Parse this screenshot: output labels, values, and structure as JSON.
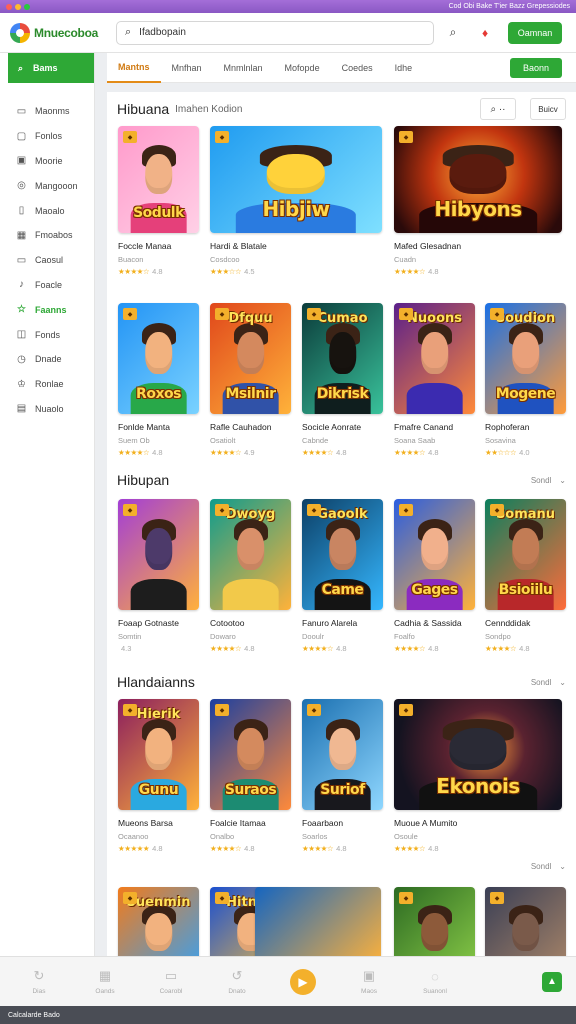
{
  "titlebar": {
    "text": "Cod Obi Bake T'ier Bazz Grepessiodes"
  },
  "topbar": {
    "logo_text": "Mnuecoboa",
    "search_value": "Ifadbopain",
    "cta_label": "Oamnan"
  },
  "sidebar": {
    "home_label": "Bams",
    "items": [
      {
        "label": "Maonms",
        "icon": "controller-icon",
        "glyph": "▭"
      },
      {
        "label": "Fonlos",
        "icon": "folder-icon",
        "glyph": "▢"
      },
      {
        "label": "Moorie",
        "icon": "film-icon",
        "glyph": "▣"
      },
      {
        "label": "Mangooon",
        "icon": "disc-icon",
        "glyph": "◎"
      },
      {
        "label": "Maoalo",
        "icon": "bookmark-icon",
        "glyph": "▯"
      },
      {
        "label": "Fmoabos",
        "icon": "gift-icon",
        "glyph": "▦"
      },
      {
        "label": "Caosul",
        "icon": "tv-icon",
        "glyph": "▭"
      },
      {
        "label": "Foacle",
        "icon": "music-icon",
        "glyph": "♪"
      },
      {
        "label": "Faanns",
        "icon": "star-icon",
        "glyph": "☆"
      },
      {
        "label": "Fonds",
        "icon": "puzzle-icon",
        "glyph": "◫"
      },
      {
        "label": "Dnade",
        "icon": "clock-icon",
        "glyph": "◷"
      },
      {
        "label": "Ronlae",
        "icon": "trophy-icon",
        "glyph": "♔"
      },
      {
        "label": "Nuaolo",
        "icon": "grid-icon",
        "glyph": "▤"
      }
    ],
    "active_index": 8
  },
  "tabs": [
    "Mantns",
    "Mnfhan",
    "Mnmlnlan",
    "Mofopde",
    "Coedes",
    "Idhe"
  ],
  "tab_button": "Baonn",
  "sections": [
    {
      "title": "Hibuana",
      "subtitle": "Imahen Kodion",
      "search_label": "⌕ ··",
      "filter_label": "Buicv",
      "cards": [
        {
          "title": "Foccle Manaa",
          "sub": "Buacon",
          "stars": "★★★★☆",
          "rating": "4.8",
          "thumb_text": "Sodulk",
          "top_text": "",
          "bg": "linear-gradient(135deg,#ff9acb,#ffd0e6)",
          "skin": "#f1b287",
          "body": "#e5407a",
          "wide": false
        },
        {
          "title": "Hardi & Blatale",
          "sub": "Cosdcoo",
          "stars": "★★★☆☆",
          "rating": "4.5",
          "thumb_text": "Hibjiw",
          "top_text": "",
          "bg": "linear-gradient(135deg,#1f9bf0,#7fe0ff)",
          "skin": "#ffd23a",
          "body": "#2a7be0",
          "wide": true
        },
        {
          "title": "Mafed Glesadnan",
          "sub": "Cuadn",
          "stars": "★★★★☆",
          "rating": "4.8",
          "thumb_text": "Hibyons",
          "top_text": "",
          "bg": "radial-gradient(circle at 50% 45%,#ffb23a,#c2350f 45%,#2a0a0a 90%)",
          "skin": "#5a1b0e",
          "body": "#250707",
          "wide": true
        }
      ]
    },
    {
      "title": "",
      "subtitle": "",
      "cards": [
        {
          "title": "Fonlde Manta",
          "sub": "Suem Ob",
          "stars": "★★★★☆",
          "rating": "4.8",
          "thumb_text": "Roxos",
          "top_text": "",
          "bg": "linear-gradient(135deg,#2394f5,#7ad2ff)",
          "skin": "#f2b27f",
          "body": "#28a849"
        },
        {
          "title": "Rafle Cauhadon",
          "sub": "Osatiolt",
          "stars": "★★★★☆",
          "rating": "4.9",
          "thumb_text": "Msilnir",
          "top_text": "Dfquu",
          "bg": "linear-gradient(135deg,#e0471b,#ffb23a)",
          "skin": "#d4895e",
          "body": "#3052a8"
        },
        {
          "title": "Socicle Aonrate",
          "sub": "Cabnde",
          "stars": "★★★★☆",
          "rating": "4.8",
          "thumb_text": "Dikrisk",
          "top_text": "Cumao",
          "bg": "linear-gradient(135deg,#0b3b3a,#39c29b)",
          "skin": "#17130f",
          "body": "#0f1e1e"
        },
        {
          "title": "Fmafre Canand",
          "sub": "Soana Saab",
          "stars": "★★★★☆",
          "rating": "4.8",
          "thumb_text": "",
          "top_text": "Nuoons",
          "bg": "linear-gradient(135deg,#5a1f8a,#ff8a3a)",
          "skin": "#e9a07a",
          "body": "#3b2bb0"
        },
        {
          "title": "Rophoferan",
          "sub": "Sosavina",
          "stars": "★★☆☆☆",
          "rating": "4.0",
          "thumb_text": "Mogene",
          "top_text": "Soudion",
          "bg": "linear-gradient(135deg,#1970e6,#ff9b3a)",
          "skin": "#e9a07a",
          "body": "#1f52c0"
        }
      ]
    },
    {
      "title": "Hibupan",
      "more_label": "Sondl",
      "cards": [
        {
          "title": "Foaap Gotnaste",
          "sub": "Somtin",
          "stars": "",
          "rating": "4.3",
          "thumb_text": "",
          "top_text": "",
          "bg": "linear-gradient(135deg,#a23ed6,#ffb03b)",
          "skin": "#4d3a6a",
          "body": "#1d1d1d"
        },
        {
          "title": "Cotootoo",
          "sub": "Dowaro",
          "stars": "★★★★☆",
          "rating": "4.8",
          "thumb_text": "",
          "top_text": "Dwoyg",
          "bg": "linear-gradient(135deg,#0f9c8d,#ffb23a)",
          "skin": "#d9906a",
          "body": "#f2c94a"
        },
        {
          "title": "Fanuro Alarela",
          "sub": "Dooulr",
          "stars": "★★★★☆",
          "rating": "4.8",
          "thumb_text": "Came",
          "top_text": "Gaoolk",
          "bg": "linear-gradient(135deg,#0c3f66,#35b7ff)",
          "skin": "#c98562",
          "body": "#141414"
        },
        {
          "title": "Cadhia & Sassida",
          "sub": "Foalfo",
          "stars": "★★★★☆",
          "rating": "4.8",
          "thumb_text": "Gages",
          "top_text": "",
          "bg": "linear-gradient(135deg,#2a5de0,#ffb23a)",
          "skin": "#f1b08c",
          "body": "#8b2bc0"
        },
        {
          "title": "Cennddidak",
          "sub": "Sondpo",
          "stars": "★★★★☆",
          "rating": "4.8",
          "thumb_text": "Bsioiilu",
          "top_text": "Somanu",
          "bg": "linear-gradient(135deg,#0b7f5d,#ff6b3a)",
          "skin": "#c27c55",
          "body": "#b8282a"
        }
      ]
    },
    {
      "title": "Hlandaianns",
      "more_label": "Sondl",
      "cards": [
        {
          "title": "Mueons Barsa",
          "sub": "Ocaanoo",
          "stars": "★★★★★",
          "rating": "4.8",
          "thumb_text": "Gunu",
          "top_text": "Hierik",
          "bg": "linear-gradient(135deg,#8b1e5e,#ffb23a)",
          "skin": "#f2b27f",
          "body": "#2aa9e0"
        },
        {
          "title": "Foalcie Itamaa",
          "sub": "Onalbo",
          "stars": "★★★★☆",
          "rating": "4.8",
          "thumb_text": "Suraos",
          "top_text": "",
          "bg": "linear-gradient(135deg,#1b3fa0,#ff8a3a)",
          "skin": "#d48a5e",
          "body": "#1c8b72"
        },
        {
          "title": "Foaarbaon",
          "sub": "Soarlos",
          "stars": "★★★★☆",
          "rating": "4.8",
          "thumb_text": "Suriof",
          "top_text": "",
          "bg": "linear-gradient(135deg,#1a6fb0,#8fd7ff)",
          "skin": "#f0b892",
          "body": "#18181d"
        },
        {
          "title": "Muoue A Mumito",
          "sub": "Osoule",
          "stars": "★★★★☆",
          "rating": "4.8",
          "thumb_text": "Ekonois",
          "top_text": "",
          "bg": "radial-gradient(circle at 55% 45%,#ff9b3a,#5a2230 35%,#141320 80%)",
          "skin": "#2a2a35",
          "body": "#111",
          "wide": true
        }
      ]
    },
    {
      "title": "",
      "more_label": "Sondl",
      "cards": [
        {
          "bg": "linear-gradient(135deg,#f27b1b,#2ba3ff)",
          "skin": "#f2b27f",
          "body": "#e23a2a",
          "top_text": "Suenmin"
        },
        {
          "bg": "linear-gradient(135deg,#1a4fd0,#ffc43a)",
          "skin": "#f2b27f",
          "body": "#2b2bb0",
          "top_text": "Hitnoo"
        },
        {
          "bg": "linear-gradient(135deg,#2c6a22,#8fd14a)",
          "skin": "#8d5a3a",
          "body": "#3b2a1c",
          "top_text": ""
        },
        {
          "bg": "linear-gradient(135deg,#3a3f55,#b08a6a)",
          "skin": "#7a5a4a",
          "body": "#222",
          "top_text": ""
        }
      ]
    }
  ],
  "bottom_nav": [
    {
      "label": "Dias",
      "icon": "refresh-icon",
      "glyph": "↻"
    },
    {
      "label": "Oands",
      "icon": "grid-icon",
      "glyph": "▦"
    },
    {
      "label": "Coarobl",
      "icon": "book-icon",
      "glyph": "▭"
    },
    {
      "label": "Dnato",
      "icon": "history-icon",
      "glyph": "↺"
    },
    {
      "label": "",
      "icon": "play-icon",
      "glyph": "▶"
    },
    {
      "label": "Maos",
      "icon": "image-icon",
      "glyph": "▣"
    },
    {
      "label": "Suanonl",
      "icon": "settings-icon",
      "glyph": "◌"
    }
  ],
  "statusbar": {
    "text": "Calcalarde Bado"
  }
}
